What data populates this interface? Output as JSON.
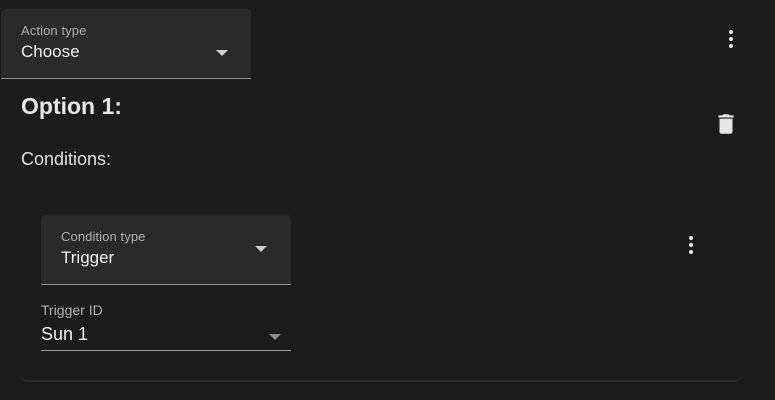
{
  "action_select": {
    "label": "Action type",
    "value": "Choose",
    "arrow_icon": "dropdown-arrow-icon"
  },
  "action_menu_icon": "more-vert-icon",
  "option": {
    "title": "Option 1:",
    "delete_icon": "trash-icon",
    "conditions_label": "Conditions:"
  },
  "condition": {
    "type_select": {
      "label": "Condition type",
      "value": "Trigger",
      "arrow_icon": "dropdown-arrow-icon"
    },
    "menu_icon": "more-vert-icon",
    "trigger_id": {
      "label": "Trigger ID",
      "value": "Sun 1",
      "arrow_icon": "dropdown-arrow-icon"
    }
  },
  "colors": {
    "background": "#1c1c1c",
    "field_fill": "#2a2a2a",
    "text_primary": "#e1e1e1",
    "text_secondary": "#b0b0b0"
  }
}
